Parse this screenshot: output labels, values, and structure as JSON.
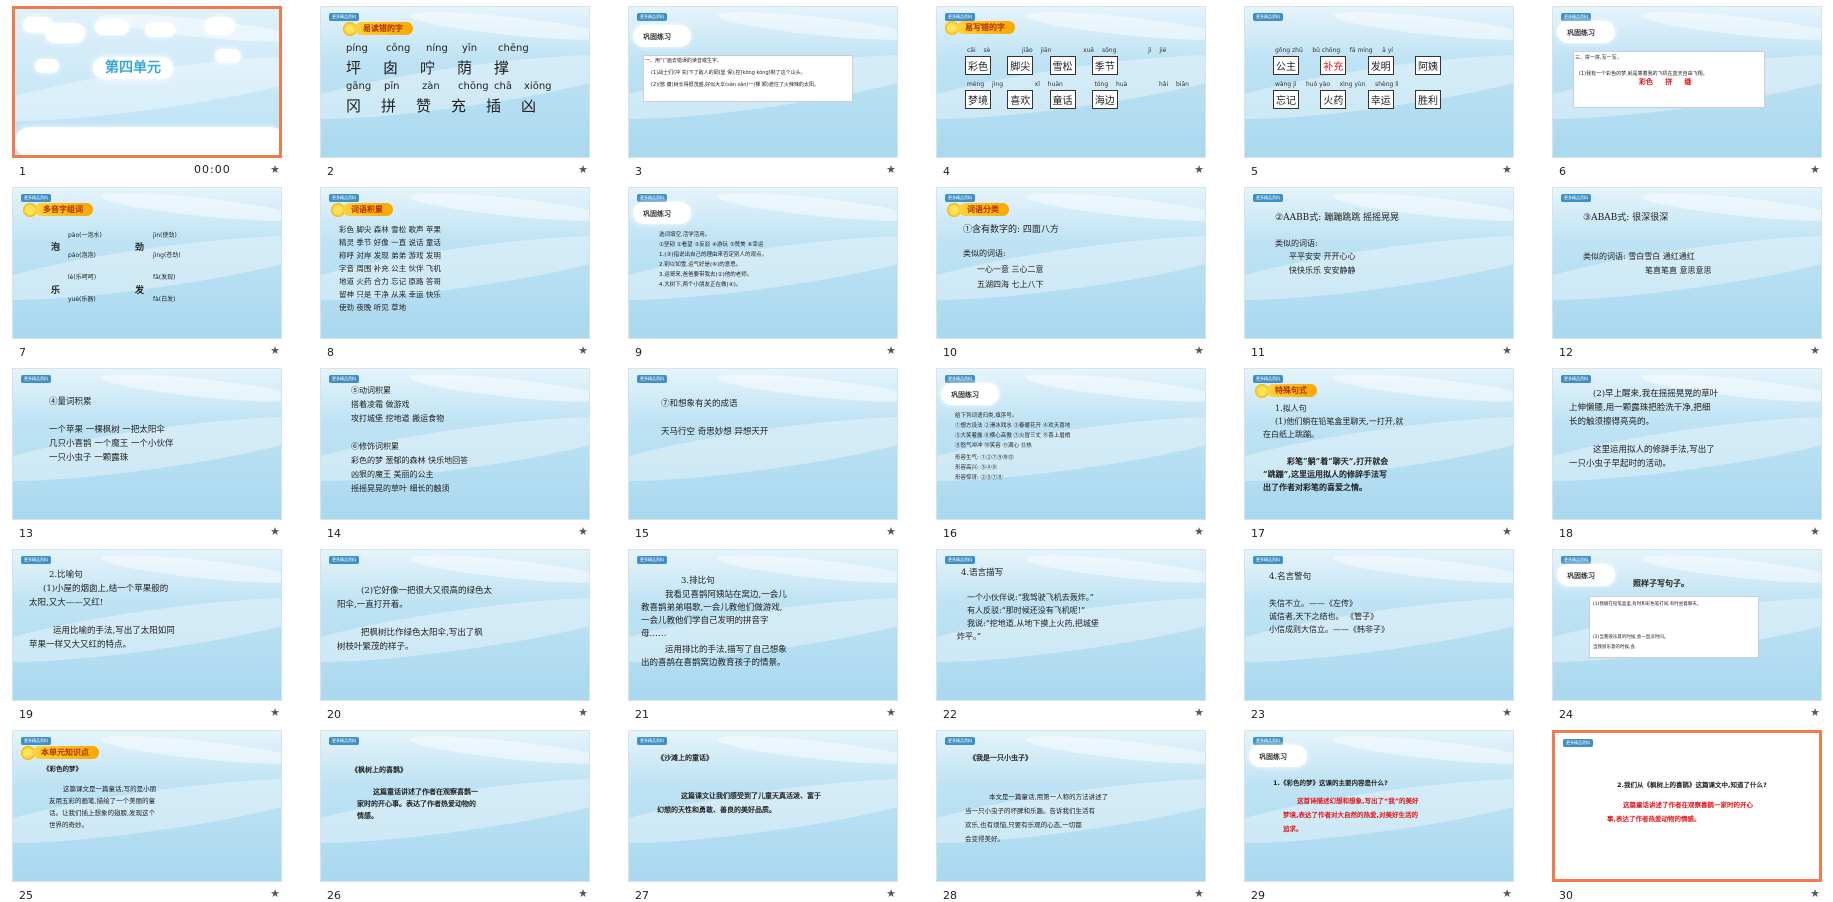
{
  "colors": {
    "selected_border": "#f07b4b",
    "accent_red": "#e0161a",
    "banner": "#f7a800"
  },
  "slide1": {
    "title": "第四单元",
    "time": "00:00"
  },
  "slide2": {
    "banner": "易读错的字",
    "row1": [
      [
        "píng",
        "坪"
      ],
      [
        "cōng",
        "囱"
      ],
      [
        "níng",
        "咛"
      ],
      [
        "yīn",
        "荫"
      ],
      [
        "chēng",
        "撑"
      ]
    ],
    "row2": [
      [
        "gāng",
        "冈"
      ],
      [
        "pīn",
        "拼"
      ],
      [
        "zàn",
        "赞"
      ],
      [
        "chōng",
        "充"
      ],
      [
        "chā",
        "插"
      ],
      [
        "xiōng",
        "凶"
      ]
    ]
  },
  "slide3": {
    "cloud": "巩固练习",
    "line1": "一、用“\\”画去错误的读音或生字。",
    "line2": "(1)战士们(冲  充)下了敌人的碉(堡  保),控(kōng kòng)制了这个山头。",
    "line3": "(2)(憋  瘪)树长得很茂盛,好似大伞(sàn sǎn)一(棵  颗)遮住了火辣辣的太阳。"
  },
  "slide4": {
    "banner": "易写错的字",
    "pinyin": [
      "cǎi sè",
      "jiǎo jiān",
      "xuě sōng",
      "jì jié",
      "mèng jìng",
      "xǐ huān",
      "tóng huà",
      "hǎi biān"
    ],
    "words": [
      "彩色",
      "脚尖",
      "雪松",
      "季节",
      "梦境",
      "喜欢",
      "童话",
      "海边"
    ]
  },
  "slide5": {
    "pinyin": [
      "gōng zhǔ",
      "bǔ chōng",
      "fā míng",
      "ā yí",
      "wàng jì",
      "huǒ yào",
      "xìng yùn",
      "shèng lì"
    ],
    "words": [
      "公主",
      "补充",
      "发明",
      "阿姨",
      "忘记",
      "火药",
      "幸运",
      "胜利"
    ]
  },
  "slide6": {
    "cloud": "巩固练习",
    "line1": "三、拼一拼,写一写。",
    "line2": "(1)我有一个彩色的梦,就是乘着我的飞机在蓝天自由飞翔。",
    "words": [
      "彩色",
      "拼",
      "缝"
    ]
  },
  "slide7": {
    "banner": "多音字组词",
    "items": [
      "pào(一泡水)",
      "páo(泡泡)",
      "jìn(使劲)",
      "jìng(苍劲)",
      "lè(乐呵呵)",
      "yuè(乐器)",
      "fā(发现)",
      "fà(白发)"
    ],
    "heads": [
      "泡",
      "劲",
      "乐",
      "发"
    ]
  },
  "slide8": {
    "banner": "词语积累",
    "rows": [
      "彩色  脚尖  森林  雪松  歌声  苹果",
      "精灵  季节  好像  一直  说话  童话",
      "称呼  对岸  发现  弟弟  游戏  发明",
      "字音  周围  补充  公主  伙伴  飞机",
      "地道  火药  合力  忘记  原路  答哥",
      "留神  只是  干净  从来  幸运  快乐",
      "使劲  夜晚  听见  草地"
    ]
  },
  "slide9": {
    "cloud": "巩固练习",
    "lines": [
      "选词填空,活学活用。",
      "①坚韧 ②看望 ③反驳 ④游玩 ⑤赞美 ⑥幸运",
      "1.(③)指说出自己的理由来否定别人的观点。",
      "2.别以如雪,运气好是(⑥)的意思。",
      "3.运哥来,爸爸要带我去(②)他的老师。",
      "4.大树下,两个小朋友正在做(④)。"
    ]
  },
  "slide10": {
    "banner": "词语分类",
    "line1": "①含有数字的:  四面八方",
    "line2": "类似的词语:",
    "line3": "一心一意      三心二意",
    "line4": "五湖四海      七上八下"
  },
  "slide11": {
    "line1": "②AABB式: 蹦蹦跳跳  摇摇晃晃",
    "line2": "类似的词语:",
    "line3": "平平安安      开开心心",
    "line4": "快快乐乐      安安静静"
  },
  "slide12": {
    "line1": "③ABAB式:      很深很深",
    "line2": "类似的词语: 雪白雪白  通红通红",
    "line3": "笔直笔直  意思意思"
  },
  "slide13": {
    "lines": [
      "④量词积累",
      "",
      "一个苹果    一棵枫树   一把太阳伞",
      "几只小喜鹊   一个魔王   一个小伙伴",
      "一只小虫子   一颗露珠"
    ]
  },
  "slide14": {
    "lines": [
      "⑤动词积累",
      "搭着凌霜    做游戏",
      "攻打城堡   挖地道   搬运食物",
      "",
      "⑥修饰词积累",
      "彩色的梦  葱郁的森林  快乐地回答",
      "凶狠的魔王   美丽的公主",
      "摇摇晃晃的草叶   细长的触须"
    ]
  },
  "slide15": {
    "line1": "⑦和想象有关的成语",
    "line2": "天马行空   奇思妙想   异想天开"
  },
  "slide16": {
    "cloud": "巩固练习",
    "lines": [
      "给下列词语归类,填序号。",
      "①想方设法  ②滑冰戏水  ③春暖花开  ④欢天喜地",
      "⑤大笑着露  ⑥横心高傲  ⑦火冒三丈  ⑧喜上眉梢",
      "⑨怒气冲冲  ⑩笑容  ⑪满心  ⑫热",
      "形容生气:  ①②⑦⑨⑩⑫",
      "形容高兴:  ③④⑧",
      "形容惊讶:  ②⑤⑦⑪"
    ]
  },
  "slide17": {
    "banner": "特殊句式",
    "l1": "1.拟人句",
    "l2": "(1)他们躺在铅笔盒里聊天,一打开,就",
    "l3": "在白纸上跳蹦。",
    "l4": "彩笔“躺”着“聊天”,打开就会",
    "l5": "“跳蹦”,这里运用拟人的修辞手法写",
    "l6": "出了作者对彩笔的喜爱之情。"
  },
  "slide18": {
    "lines": [
      "(2)早上醒来,我在摇摇晃晃的草叶",
      "上伸懒腰,用一颗露珠把脸洗干净,把细",
      "长的触须擦得亮亮的。",
      "",
      "这里运用拟人的修辞手法,写出了",
      "一只小虫子早起时的活动。"
    ]
  },
  "slide19": {
    "lines": [
      "2.比喻句",
      "(1)小屋的烟囱上,结一个苹果般的",
      "太阳,又大——又红!",
      "",
      "运用比喻的手法,写出了太阳如同",
      "苹果一样又大又红的特点。"
    ]
  },
  "slide20": {
    "lines": [
      "(2)它好像一把很大又很高的绿色太",
      "阳伞,一直打开着。",
      "",
      "把枫树比作绿色太阳伞,写出了枫",
      "树枝叶繁茂的样子。"
    ]
  },
  "slide21": {
    "lines": [
      "3.排比句",
      "我看见喜鹊阿姨站在窝边,一会儿",
      "教喜鹊弟弟唱歌,一会儿教他们做游戏,",
      "一会儿教他们学自己发明的拼音字",
      "母……",
      "运用排比的手法,描写了自己想象",
      "出的喜鹊在喜鹊窝边教育孩子的情景。"
    ]
  },
  "slide22": {
    "lines": [
      "4.语言描写",
      "",
      "一个小伙伴说:“我驾驶飞机去轰炸。”",
      "有人反驳:“那时候还没有飞机呢!”",
      "我说:“挖地道,从地下摸上火药,把城堡",
      "炸平。”"
    ]
  },
  "slide23": {
    "lines": [
      "4.名言警句",
      "",
      "失信不立。——《左传》",
      "诚信者,天下之结也。        《管子》",
      "小信成则大信立。——《韩非子》"
    ]
  },
  "slide24": {
    "cloud": "巩固练习",
    "title": "照样子写句子。",
    "l1": "(1)我躺在铅笔盒里,有时和彩色笔打闹,有时坐着聊天。",
    "l2": "(2)当我很乐意的时候,会一直没时间。",
    "l3": "当我很乐意的时候,会"
  },
  "slide25": {
    "banner": "本单元知识点",
    "title": "《彩色的梦》",
    "lines": [
      "这篇课文是一篇童话,写的是小朋",
      "友用五彩的画笔,描绘了一个美丽的童",
      "话。让我们插上想象的翅膀,发现这个",
      "世界的奇妙。"
    ]
  },
  "slide26": {
    "title": "《枫树上的喜鹊》",
    "lines": [
      "这篇童话讲述了作者在观察喜鹊一",
      "家时的开心事。表达了作者热爱动物的",
      "情感。"
    ]
  },
  "slide27": {
    "title": "《沙滩上的童话》",
    "lines": [
      "这篇课文让我们感受到了儿童天真活泼、富于",
      "幻想的天性和勇敢、善良的美好品质。"
    ]
  },
  "slide28": {
    "title": "《我是一只小虫子》",
    "lines": [
      "本文是一篇童话,用第一人称的方法讲述了",
      "当一只小虫子的坏脾和乐趣。告诉我们生活有",
      "欢乐,也有烦恼,只要有乐观的心态,一切都",
      "会变得美好。"
    ]
  },
  "slide29": {
    "cloud": "巩固练习",
    "q": "1.《彩色的梦》这课的主要内容是什么?",
    "a1": "这首诗描述幻想和想象,写出了“我”的美好",
    "a2": "梦境,表达了作者对大自然的热爱,对美好生活的",
    "a3": "追求。"
  },
  "slide30": {
    "q": "2.我们从《枫树上的喜鹊》这篇课文中,知道了什么?",
    "a1": "这篇童话讲述了作者在观察喜鹊一家时的开心",
    "a2": "事,表达了作者热爱动物的情感。"
  },
  "slide_tag": "更多精品资料"
}
